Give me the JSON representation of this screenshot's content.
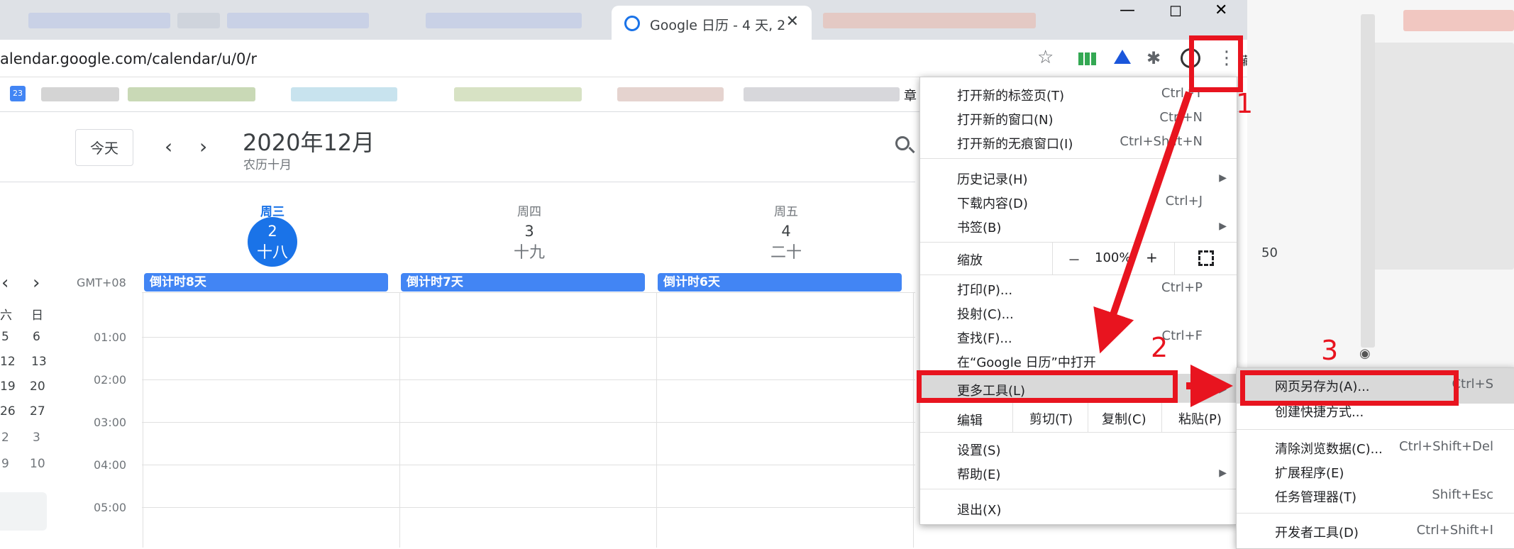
{
  "browser": {
    "active_tab_title": "Google 日历 - 4 天, 2",
    "url": "alendar.google.com/calendar/u/0/r",
    "bookmark_folder_char": "章",
    "right_overlap_text": "藏"
  },
  "calendar": {
    "today_button": "今天",
    "prev_icon": "‹",
    "next_icon": "›",
    "month_title": "2020年12月",
    "lunar_month": "农历十月",
    "timezone": "GMT+08",
    "days": [
      {
        "name": "周三",
        "number": "2",
        "lunar": "十八",
        "event": "倒计时8天"
      },
      {
        "name": "周四",
        "number": "3",
        "lunar": "十九",
        "event": "倒计时7天"
      },
      {
        "name": "周五",
        "number": "4",
        "lunar": "二十",
        "event": "倒计时6天"
      }
    ],
    "hours": [
      "01:00",
      "02:00",
      "03:00",
      "04:00",
      "05:00"
    ],
    "mini_calendar": {
      "headers": [
        "六",
        "日"
      ],
      "rows": [
        [
          "5",
          "6"
        ],
        [
          "12",
          "13"
        ],
        [
          "19",
          "20"
        ],
        [
          "26",
          "27"
        ],
        [
          "2",
          "3"
        ],
        [
          "9",
          "10"
        ]
      ]
    }
  },
  "menu": {
    "new_tab": "打开新的标签页(T)",
    "new_tab_sc": "Ctrl+T",
    "new_window": "打开新的窗口(N)",
    "new_window_sc": "Ctrl+N",
    "incognito": "打开新的无痕窗口(I)",
    "incognito_sc": "Ctrl+Shift+N",
    "history": "历史记录(H)",
    "downloads": "下载内容(D)",
    "downloads_sc": "Ctrl+J",
    "bookmarks": "书签(B)",
    "zoom": "缩放",
    "zoom_minus": "－",
    "zoom_value": "100%",
    "zoom_plus": "+",
    "print": "打印(P)...",
    "print_sc": "Ctrl+P",
    "cast": "投射(C)...",
    "find": "查找(F)...",
    "find_sc": "Ctrl+F",
    "open_in": "在“Google 日历”中打开",
    "more_tools": "更多工具(L)",
    "edit": "编辑",
    "cut": "剪切(T)",
    "copy": "复制(C)",
    "paste": "粘贴(P)",
    "settings": "设置(S)",
    "help": "帮助(E)",
    "exit": "退出(X)"
  },
  "submenu": {
    "save_as": "网页另存为(A)...",
    "save_as_sc": "Ctrl+S",
    "shortcut": "创建快捷方式...",
    "clear_data": "清除浏览数据(C)...",
    "clear_data_sc": "Ctrl+Shift+Del",
    "extensions": "扩展程序(E)",
    "task_manager": "任务管理器(T)",
    "task_manager_sc": "Shift+Esc",
    "devtools": "开发者工具(D)",
    "devtools_sc": "Ctrl+Shift+I"
  },
  "background_fragment": "50",
  "annotations": {
    "step1": "1",
    "step2": "2",
    "step3": "3",
    "color": "#e8141f"
  }
}
